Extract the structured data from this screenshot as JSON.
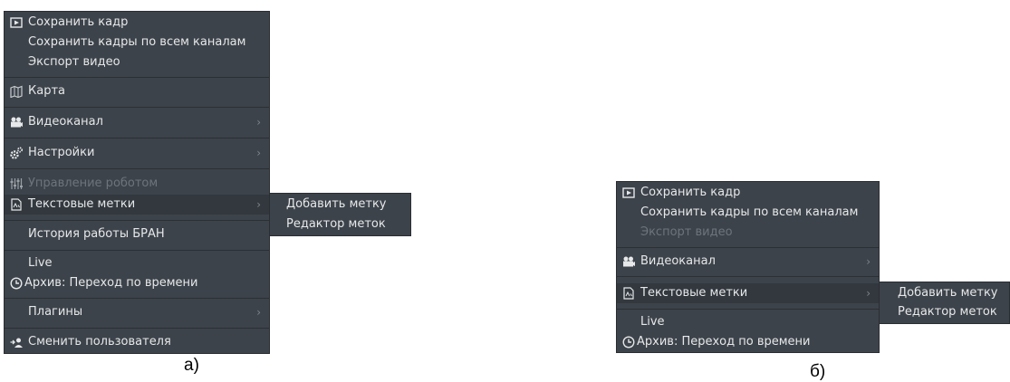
{
  "menu_a": {
    "items": [
      {
        "label": "Сохранить кадр",
        "icon": "play-frame-icon"
      },
      {
        "label": "Сохранить кадры по всем каналам"
      },
      {
        "label": "Экспорт видео"
      },
      {
        "label": "Карта",
        "icon": "map-icon"
      },
      {
        "label": "Видеоканал",
        "icon": "camera-icon",
        "arrow": "›"
      },
      {
        "label": "Настройки",
        "icon": "gears-icon",
        "arrow": "›"
      },
      {
        "label": "Управление роботом",
        "icon": "sliders-icon",
        "disabled": true
      },
      {
        "label": "Текстовые метки",
        "icon": "text-label-icon",
        "arrow": "›",
        "highlighted": true
      },
      {
        "label": "История работы БРАН"
      },
      {
        "label": "Live"
      },
      {
        "label": "Архив: Переход по времени",
        "icon": "clock-icon"
      },
      {
        "label": "Плагины",
        "arrow": "›"
      },
      {
        "label": "Сменить пользователя",
        "icon": "switch-user-icon"
      }
    ],
    "submenu": [
      "Добавить метку",
      "Редактор меток"
    ]
  },
  "menu_b": {
    "items": [
      {
        "label": "Сохранить кадр",
        "icon": "play-frame-icon"
      },
      {
        "label": "Сохранить кадры по всем каналам"
      },
      {
        "label": "Экспорт видео",
        "disabled": true
      },
      {
        "label": "Видеоканал",
        "icon": "camera-icon",
        "arrow": "›"
      },
      {
        "label": "Текстовые метки",
        "icon": "text-label-icon",
        "arrow": "›",
        "highlighted": true
      },
      {
        "label": "Live"
      },
      {
        "label": "Архив: Переход по времени",
        "icon": "clock-icon"
      }
    ],
    "submenu": [
      "Добавить метку",
      "Редактор меток"
    ]
  },
  "captions": {
    "a": "а)",
    "b": "б)"
  },
  "colors": {
    "menu_bg": "#3d434a",
    "text": "#e6e8ea",
    "disabled": "#6d747b",
    "highlight": "#32383e"
  }
}
